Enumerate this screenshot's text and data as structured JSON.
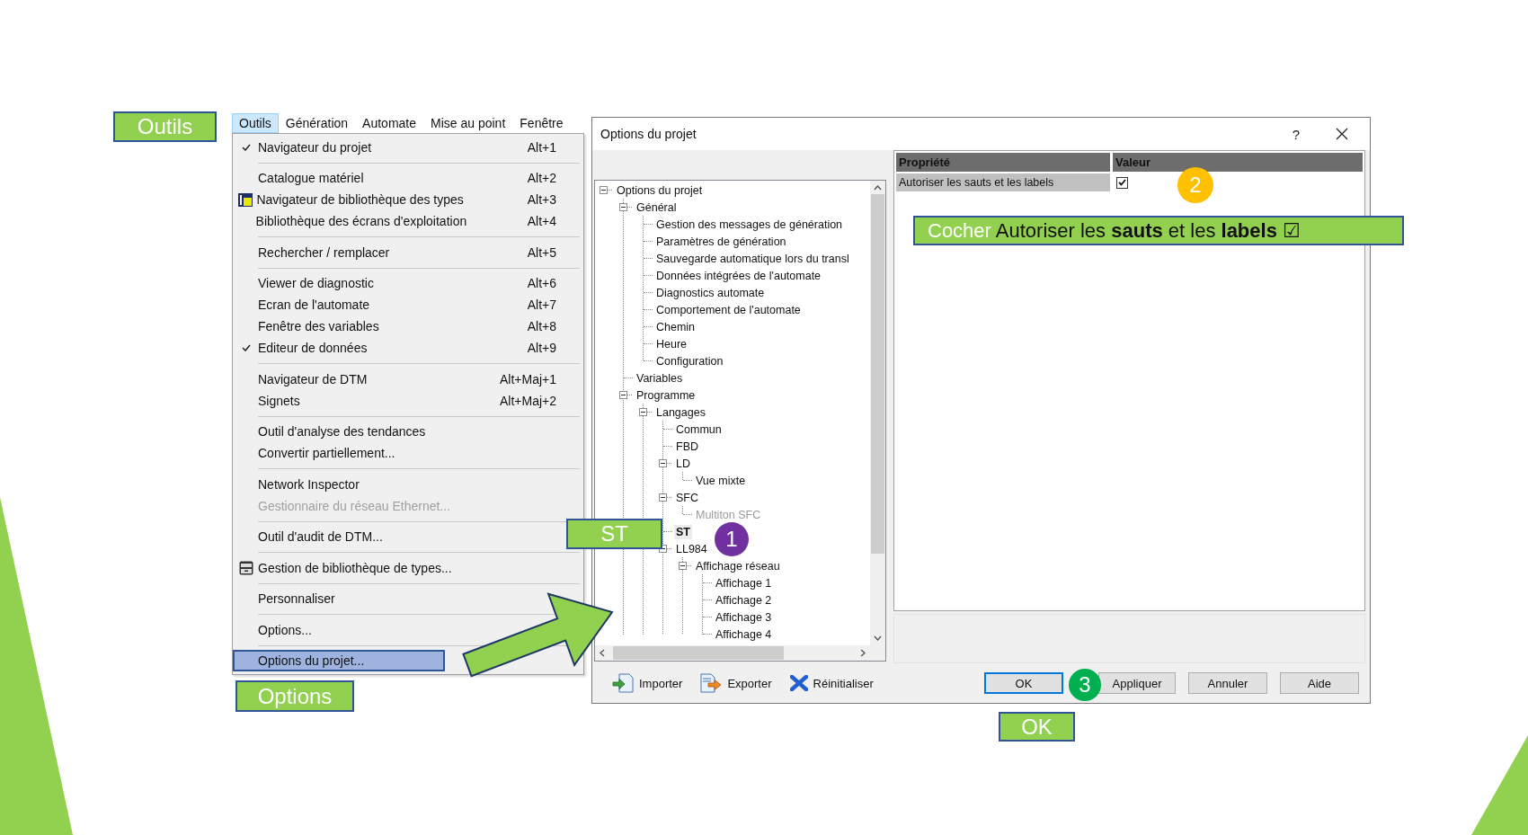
{
  "callouts": [
    {
      "text": "Outils"
    },
    {
      "text": "ST"
    },
    {
      "text": "Options"
    },
    {
      "text": "OK"
    }
  ],
  "instruction": {
    "lead": "Cocher",
    "text": "Autoriser les **sauts** et les **labels** ☑"
  },
  "steps": [
    {
      "label": "1",
      "color": "#7030a0"
    },
    {
      "label": "2",
      "color": "#ffc000"
    },
    {
      "label": "3",
      "color": "#00b050"
    }
  ],
  "menu_bar": [
    {
      "label": "Outils",
      "selected": true
    },
    {
      "label": "Génération",
      "selected": false
    },
    {
      "label": "Automate",
      "selected": false
    },
    {
      "label": "Mise au point",
      "selected": false
    },
    {
      "label": "Fenêtre",
      "selected": false
    }
  ],
  "menu": [
    {
      "kind": "item",
      "label": "Navigateur du projet",
      "shortcut": "Alt+1",
      "checked": true,
      "disabled": false,
      "selected": false
    },
    {
      "kind": "separator"
    },
    {
      "kind": "item",
      "label": "Catalogue matériel",
      "shortcut": "Alt+2",
      "checked": false,
      "disabled": false,
      "selected": false
    },
    {
      "kind": "item",
      "label": "Navigateur de bibliothèque des types",
      "shortcut": "Alt+3",
      "checked": false,
      "disabled": false,
      "selected": false
    },
    {
      "kind": "item",
      "label": "Bibliothèque des écrans d'exploitation",
      "shortcut": "Alt+4",
      "checked": false,
      "disabled": false,
      "selected": false
    },
    {
      "kind": "separator"
    },
    {
      "kind": "item",
      "label": "Rechercher / remplacer",
      "shortcut": "Alt+5",
      "checked": false,
      "disabled": false,
      "selected": false
    },
    {
      "kind": "separator"
    },
    {
      "kind": "item",
      "label": "Viewer de diagnostic",
      "shortcut": "Alt+6",
      "checked": false,
      "disabled": false,
      "selected": false
    },
    {
      "kind": "item",
      "label": "Ecran de l'automate",
      "shortcut": "Alt+7",
      "checked": false,
      "disabled": false,
      "selected": false
    },
    {
      "kind": "item",
      "label": "Fenêtre des variables",
      "shortcut": "Alt+8",
      "checked": false,
      "disabled": false,
      "selected": false
    },
    {
      "kind": "item",
      "label": "Editeur de données",
      "shortcut": "Alt+9",
      "checked": true,
      "disabled": false,
      "selected": false
    },
    {
      "kind": "separator"
    },
    {
      "kind": "item",
      "label": "Navigateur de DTM",
      "shortcut": "Alt+Maj+1",
      "checked": false,
      "disabled": false,
      "selected": false
    },
    {
      "kind": "item",
      "label": "Signets",
      "shortcut": "Alt+Maj+2",
      "checked": false,
      "disabled": false,
      "selected": false
    },
    {
      "kind": "separator"
    },
    {
      "kind": "item",
      "label": "Outil d'analyse des tendances",
      "checked": false,
      "disabled": false,
      "selected": false
    },
    {
      "kind": "item",
      "label": "Convertir partiellement...",
      "checked": false,
      "disabled": false,
      "selected": false
    },
    {
      "kind": "separator"
    },
    {
      "kind": "item",
      "label": "Network Inspector",
      "checked": false,
      "disabled": false,
      "selected": false
    },
    {
      "kind": "item",
      "label": "Gestionnaire du réseau Ethernet...",
      "checked": false,
      "disabled": true,
      "selected": false
    },
    {
      "kind": "separator"
    },
    {
      "kind": "item",
      "label": "Outil d'audit de DTM...",
      "checked": false,
      "disabled": false,
      "selected": false
    },
    {
      "kind": "separator"
    },
    {
      "kind": "item",
      "label": "Gestion de bibliothèque de types...",
      "checked": false,
      "disabled": false,
      "selected": false
    },
    {
      "kind": "separator"
    },
    {
      "kind": "item",
      "label": "Personnaliser",
      "checked": false,
      "disabled": false,
      "selected": false
    },
    {
      "kind": "separator"
    },
    {
      "kind": "item",
      "label": "Options...",
      "checked": false,
      "disabled": false,
      "selected": false
    },
    {
      "kind": "separator"
    },
    {
      "kind": "item",
      "label": "Options du projet...",
      "checked": false,
      "disabled": false,
      "selected": true
    }
  ],
  "dialog": {
    "title": "Options du projet",
    "help": "?",
    "tree": [
      {
        "label": "Options du projet",
        "expanded": true,
        "selected": false,
        "disabled": false,
        "children": [
          {
            "label": "Général",
            "expanded": true,
            "selected": false,
            "disabled": false,
            "children": [
              {
                "label": "Gestion des messages de génération",
                "selected": false,
                "disabled": false
              },
              {
                "label": "Paramètres de génération",
                "selected": false,
                "disabled": false
              },
              {
                "label": "Sauvegarde automatique lors du transl",
                "selected": false,
                "disabled": false
              },
              {
                "label": "Données intégrées de l'automate",
                "selected": false,
                "disabled": false
              },
              {
                "label": "Diagnostics automate",
                "selected": false,
                "disabled": false
              },
              {
                "label": "Comportement de l'automate",
                "selected": false,
                "disabled": false
              },
              {
                "label": "Chemin",
                "selected": false,
                "disabled": false
              },
              {
                "label": "Heure",
                "selected": false,
                "disabled": false
              },
              {
                "label": "Configuration",
                "selected": false,
                "disabled": false
              }
            ]
          },
          {
            "label": "Variables",
            "selected": false,
            "disabled": false
          },
          {
            "label": "Programme",
            "expanded": true,
            "selected": false,
            "disabled": false,
            "children": [
              {
                "label": "Langages",
                "expanded": true,
                "selected": false,
                "disabled": false,
                "children": [
                  {
                    "label": "Commun",
                    "selected": false,
                    "disabled": false
                  },
                  {
                    "label": "FBD",
                    "selected": false,
                    "disabled": false
                  },
                  {
                    "label": "LD",
                    "expanded": true,
                    "selected": false,
                    "disabled": false,
                    "children": [
                      {
                        "label": "Vue mixte",
                        "selected": false,
                        "disabled": false
                      }
                    ]
                  },
                  {
                    "label": "SFC",
                    "expanded": true,
                    "selected": false,
                    "disabled": false,
                    "children": [
                      {
                        "label": "Multiton SFC",
                        "selected": false,
                        "disabled": true
                      }
                    ]
                  },
                  {
                    "label": "ST",
                    "selected": true,
                    "disabled": false
                  },
                  {
                    "label": "LL984",
                    "expanded": true,
                    "selected": false,
                    "disabled": false,
                    "children": [
                      {
                        "label": "Affichage réseau",
                        "expanded": true,
                        "selected": false,
                        "disabled": false,
                        "children": [
                          {
                            "label": "Affichage 1",
                            "selected": false,
                            "disabled": false
                          },
                          {
                            "label": "Affichage 2",
                            "selected": false,
                            "disabled": false
                          },
                          {
                            "label": "Affichage 3",
                            "selected": false,
                            "disabled": false
                          },
                          {
                            "label": "Affichage 4",
                            "selected": false,
                            "disabled": false
                          }
                        ]
                      }
                    ]
                  }
                ]
              }
            ]
          }
        ]
      }
    ],
    "properties": {
      "columns": [
        "Propriété",
        "Valeur"
      ],
      "rows": [
        {
          "name": "Autoriser les sauts et les labels",
          "checked": true
        }
      ]
    },
    "tools": [
      {
        "kind": "import",
        "label": "Importer"
      },
      {
        "kind": "export",
        "label": "Exporter"
      },
      {
        "kind": "reset",
        "label": "Réinitialiser"
      }
    ],
    "buttons": [
      {
        "label": "OK",
        "default": true
      },
      {
        "label": "Appliquer",
        "default": false
      },
      {
        "label": "Annuler",
        "default": false
      },
      {
        "label": "Aide",
        "default": false
      }
    ]
  }
}
